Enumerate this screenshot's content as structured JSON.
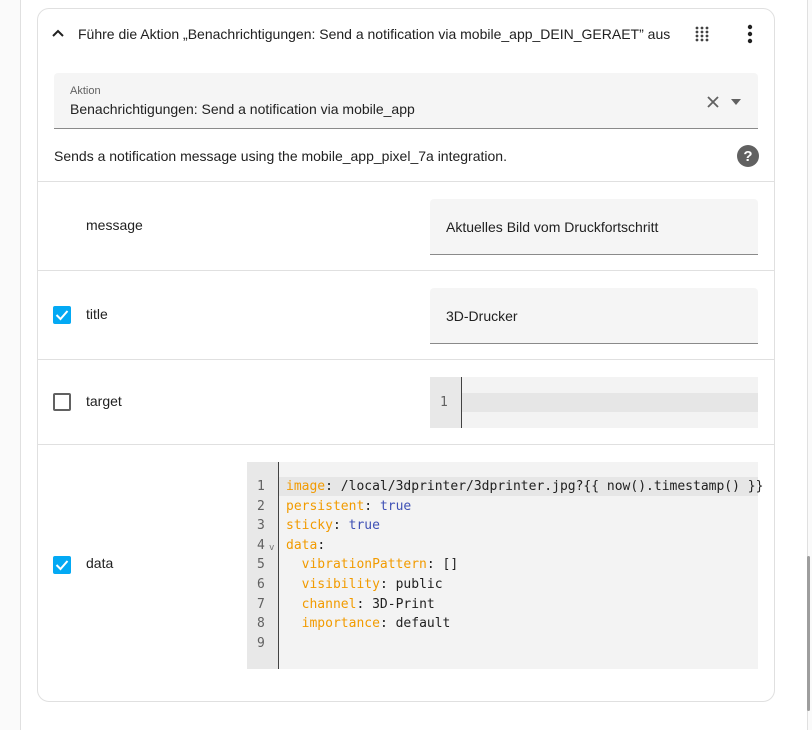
{
  "header": {
    "title": "Führe die Aktion „Benachrichtigungen: Send a notification via mobile_app_DEIN_GERAET” aus"
  },
  "action_select": {
    "label": "Aktion",
    "value": "Benachrichtigungen: Send a notification via mobile_app"
  },
  "description": "Sends a notification message using the mobile_app_pixel_7a integration.",
  "fields": {
    "message": {
      "label": "message",
      "value": "Aktuelles Bild vom Druckfortschritt"
    },
    "title": {
      "label": "title",
      "value": "3D-Drucker",
      "checked": true
    },
    "target": {
      "label": "target",
      "checked": false,
      "line_numbers": [
        "1"
      ]
    },
    "data": {
      "label": "data",
      "checked": true,
      "line_numbers": [
        "1",
        "2",
        "3",
        "4",
        "5",
        "6",
        "7",
        "8",
        "9"
      ],
      "lines": [
        {
          "key": "image",
          "sep": ": ",
          "val": "/local/3dprinter/3dprinter.jpg?{{ now().timestamp() }}",
          "indent": ""
        },
        {
          "key": "persistent",
          "sep": ": ",
          "val": "true",
          "indent": "",
          "bool": true
        },
        {
          "key": "sticky",
          "sep": ": ",
          "val": "true",
          "indent": "",
          "bool": true
        },
        {
          "key": "data",
          "sep": ":",
          "val": "",
          "indent": ""
        },
        {
          "key": "vibrationPattern",
          "sep": ": ",
          "val": "[]",
          "indent": "  "
        },
        {
          "key": "visibility",
          "sep": ": ",
          "val": "public",
          "indent": "  "
        },
        {
          "key": "channel",
          "sep": ": ",
          "val": "3D-Print",
          "indent": "  "
        },
        {
          "key": "importance",
          "sep": ": ",
          "val": "default",
          "indent": "  "
        },
        {
          "key": "",
          "sep": "",
          "val": "",
          "indent": ""
        }
      ]
    }
  },
  "colors": {
    "accent": "#03a9f4",
    "yaml_key": "#f29b00",
    "yaml_bool": "#3f51b5"
  }
}
